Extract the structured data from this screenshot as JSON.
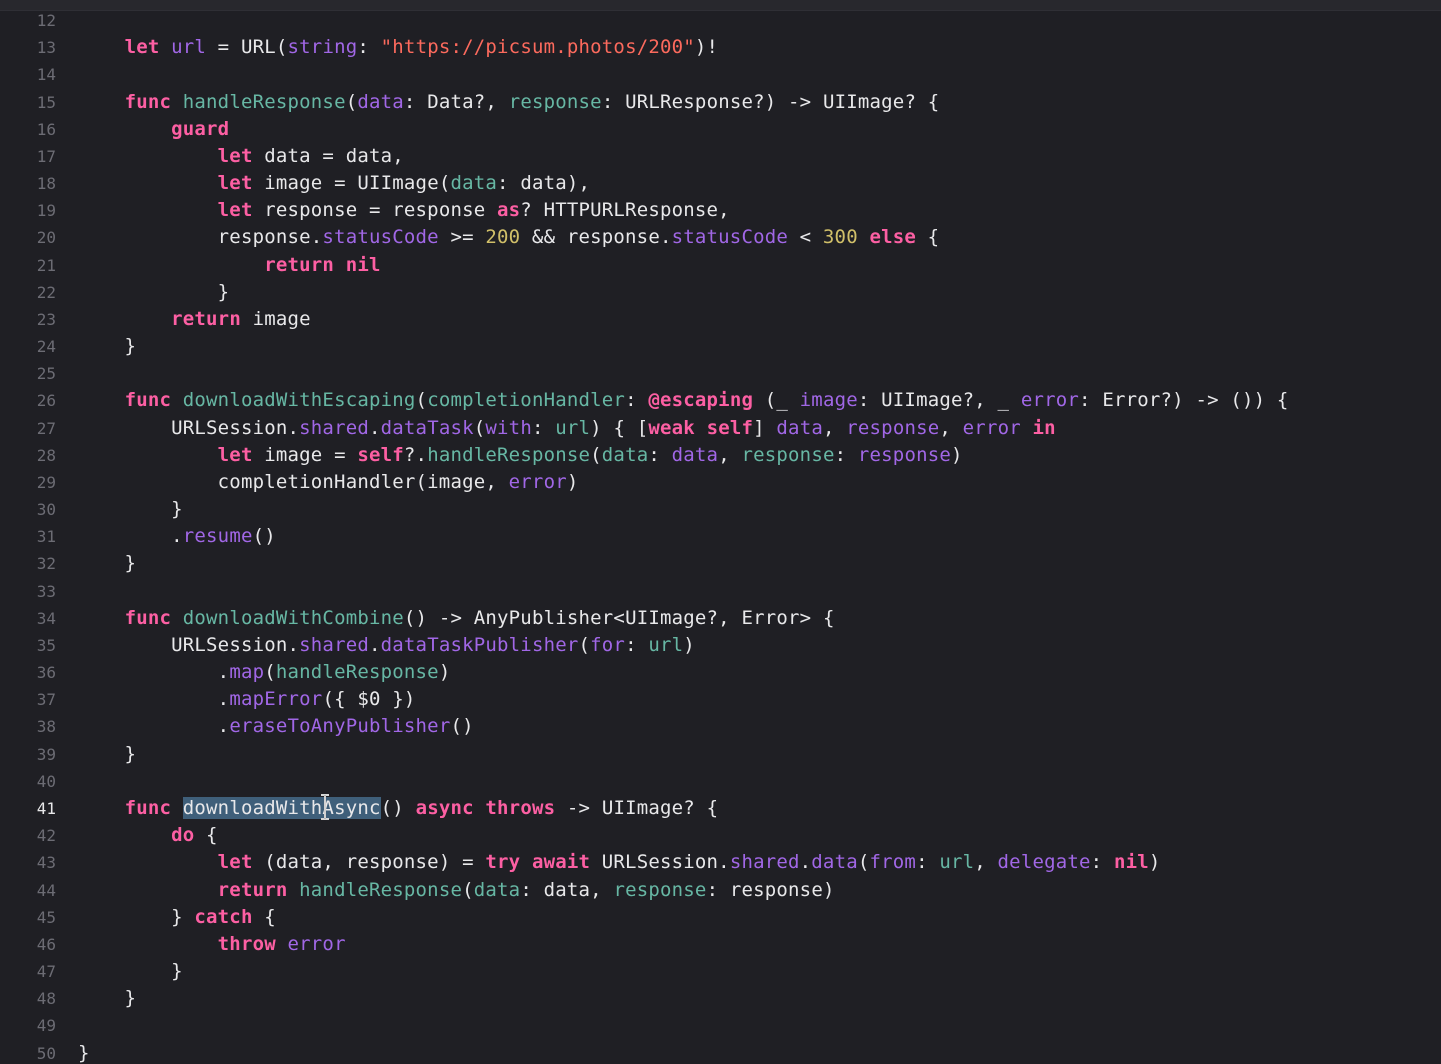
{
  "editor": {
    "current_line": "41",
    "lines": [
      {
        "n": "12",
        "tokens": []
      },
      {
        "n": "13",
        "tokens": [
          [
            "t",
            "    "
          ],
          [
            "kw",
            "let"
          ],
          [
            "t",
            " "
          ],
          [
            "pr",
            "url"
          ],
          [
            "t",
            " = "
          ],
          [
            "tyw",
            "URL"
          ],
          [
            "t",
            "("
          ],
          [
            "pr",
            "string"
          ],
          [
            "t",
            ": "
          ],
          [
            "str",
            "\"https://picsum.photos/200\""
          ],
          [
            "t",
            ")!"
          ]
        ]
      },
      {
        "n": "14",
        "tokens": []
      },
      {
        "n": "15",
        "tokens": [
          [
            "t",
            "    "
          ],
          [
            "kw",
            "func"
          ],
          [
            "t",
            " "
          ],
          [
            "fn",
            "handleResponse"
          ],
          [
            "t",
            "("
          ],
          [
            "pr",
            "data"
          ],
          [
            "t",
            ": "
          ],
          [
            "tyw",
            "Data"
          ],
          [
            "t",
            "?, "
          ],
          [
            "fn",
            "response"
          ],
          [
            "t",
            ": "
          ],
          [
            "tyw",
            "URLResponse"
          ],
          [
            "t",
            "?) -> "
          ],
          [
            "tyw",
            "UIImage"
          ],
          [
            "t",
            "? {"
          ]
        ]
      },
      {
        "n": "16",
        "tokens": [
          [
            "t",
            "        "
          ],
          [
            "kw",
            "guard"
          ]
        ]
      },
      {
        "n": "17",
        "tokens": [
          [
            "t",
            "            "
          ],
          [
            "kw",
            "let"
          ],
          [
            "t",
            " data = data,"
          ]
        ]
      },
      {
        "n": "18",
        "tokens": [
          [
            "t",
            "            "
          ],
          [
            "kw",
            "let"
          ],
          [
            "t",
            " image = "
          ],
          [
            "tyw",
            "UIImage"
          ],
          [
            "t",
            "("
          ],
          [
            "fn",
            "data"
          ],
          [
            "t",
            ": data),"
          ]
        ]
      },
      {
        "n": "19",
        "tokens": [
          [
            "t",
            "            "
          ],
          [
            "kw",
            "let"
          ],
          [
            "t",
            " response = response "
          ],
          [
            "kw",
            "as"
          ],
          [
            "t",
            "? "
          ],
          [
            "tyw",
            "HTTPURLResponse"
          ],
          [
            "t",
            ","
          ]
        ]
      },
      {
        "n": "20",
        "tokens": [
          [
            "t",
            "            response."
          ],
          [
            "pr",
            "statusCode"
          ],
          [
            "t",
            " >= "
          ],
          [
            "num",
            "200"
          ],
          [
            "t",
            " && response."
          ],
          [
            "pr",
            "statusCode"
          ],
          [
            "t",
            " < "
          ],
          [
            "num",
            "300"
          ],
          [
            "t",
            " "
          ],
          [
            "kw",
            "else"
          ],
          [
            "t",
            " {"
          ]
        ]
      },
      {
        "n": "21",
        "tokens": [
          [
            "t",
            "                "
          ],
          [
            "kw",
            "return"
          ],
          [
            "t",
            " "
          ],
          [
            "kw",
            "nil"
          ]
        ]
      },
      {
        "n": "22",
        "tokens": [
          [
            "t",
            "            }"
          ]
        ]
      },
      {
        "n": "23",
        "tokens": [
          [
            "t",
            "        "
          ],
          [
            "kw",
            "return"
          ],
          [
            "t",
            " image"
          ]
        ]
      },
      {
        "n": "24",
        "tokens": [
          [
            "t",
            "    }"
          ]
        ]
      },
      {
        "n": "25",
        "tokens": []
      },
      {
        "n": "26",
        "tokens": [
          [
            "t",
            "    "
          ],
          [
            "kw",
            "func"
          ],
          [
            "t",
            " "
          ],
          [
            "fn",
            "downloadWithEscaping"
          ],
          [
            "t",
            "("
          ],
          [
            "fn",
            "completionHandler"
          ],
          [
            "t",
            ": "
          ],
          [
            "kw",
            "@escaping"
          ],
          [
            "t",
            " (_ "
          ],
          [
            "pr",
            "image"
          ],
          [
            "t",
            ": "
          ],
          [
            "tyw",
            "UIImage"
          ],
          [
            "t",
            "?, _ "
          ],
          [
            "pr",
            "error"
          ],
          [
            "t",
            ": "
          ],
          [
            "tyw",
            "Error"
          ],
          [
            "t",
            "?) -> ()) {"
          ]
        ]
      },
      {
        "n": "27",
        "tokens": [
          [
            "t",
            "        "
          ],
          [
            "tyw",
            "URLSession"
          ],
          [
            "t",
            "."
          ],
          [
            "pr",
            "shared"
          ],
          [
            "t",
            "."
          ],
          [
            "pr",
            "dataTask"
          ],
          [
            "t",
            "("
          ],
          [
            "pr",
            "with"
          ],
          [
            "t",
            ": "
          ],
          [
            "fn",
            "url"
          ],
          [
            "t",
            ") { ["
          ],
          [
            "kw",
            "weak"
          ],
          [
            "t",
            " "
          ],
          [
            "kw",
            "self"
          ],
          [
            "t",
            "] "
          ],
          [
            "pr",
            "data"
          ],
          [
            "t",
            ", "
          ],
          [
            "pr",
            "response"
          ],
          [
            "t",
            ", "
          ],
          [
            "pr",
            "error"
          ],
          [
            "t",
            " "
          ],
          [
            "kw",
            "in"
          ]
        ]
      },
      {
        "n": "28",
        "tokens": [
          [
            "t",
            "            "
          ],
          [
            "kw",
            "let"
          ],
          [
            "t",
            " image = "
          ],
          [
            "kw",
            "self"
          ],
          [
            "t",
            "?."
          ],
          [
            "fn",
            "handleResponse"
          ],
          [
            "t",
            "("
          ],
          [
            "fn",
            "data"
          ],
          [
            "t",
            ": "
          ],
          [
            "pr",
            "data"
          ],
          [
            "t",
            ", "
          ],
          [
            "fn",
            "response"
          ],
          [
            "t",
            ": "
          ],
          [
            "pr",
            "response"
          ],
          [
            "t",
            ")"
          ]
        ]
      },
      {
        "n": "29",
        "tokens": [
          [
            "t",
            "            completionHandler(image, "
          ],
          [
            "pr",
            "error"
          ],
          [
            "t",
            ")"
          ]
        ]
      },
      {
        "n": "30",
        "tokens": [
          [
            "t",
            "        }"
          ]
        ]
      },
      {
        "n": "31",
        "tokens": [
          [
            "t",
            "        ."
          ],
          [
            "pr",
            "resume"
          ],
          [
            "t",
            "()"
          ]
        ]
      },
      {
        "n": "32",
        "tokens": [
          [
            "t",
            "    }"
          ]
        ]
      },
      {
        "n": "33",
        "tokens": []
      },
      {
        "n": "34",
        "tokens": [
          [
            "t",
            "    "
          ],
          [
            "kw",
            "func"
          ],
          [
            "t",
            " "
          ],
          [
            "fn",
            "downloadWithCombine"
          ],
          [
            "t",
            "() -> "
          ],
          [
            "tyw",
            "AnyPublisher"
          ],
          [
            "t",
            "<"
          ],
          [
            "tyw",
            "UIImage"
          ],
          [
            "t",
            "?, "
          ],
          [
            "tyw",
            "Error"
          ],
          [
            "t",
            "> {"
          ]
        ]
      },
      {
        "n": "35",
        "tokens": [
          [
            "t",
            "        "
          ],
          [
            "tyw",
            "URLSession"
          ],
          [
            "t",
            "."
          ],
          [
            "pr",
            "shared"
          ],
          [
            "t",
            "."
          ],
          [
            "pr",
            "dataTaskPublisher"
          ],
          [
            "t",
            "("
          ],
          [
            "pr",
            "for"
          ],
          [
            "t",
            ": "
          ],
          [
            "fn",
            "url"
          ],
          [
            "t",
            ")"
          ]
        ]
      },
      {
        "n": "36",
        "tokens": [
          [
            "t",
            "            ."
          ],
          [
            "pr",
            "map"
          ],
          [
            "t",
            "("
          ],
          [
            "fn",
            "handleResponse"
          ],
          [
            "t",
            ")"
          ]
        ]
      },
      {
        "n": "37",
        "tokens": [
          [
            "t",
            "            ."
          ],
          [
            "pr",
            "mapError"
          ],
          [
            "t",
            "({ $0 })"
          ]
        ]
      },
      {
        "n": "38",
        "tokens": [
          [
            "t",
            "            ."
          ],
          [
            "pr",
            "eraseToAnyPublisher"
          ],
          [
            "t",
            "()"
          ]
        ]
      },
      {
        "n": "39",
        "tokens": [
          [
            "t",
            "    }"
          ]
        ]
      },
      {
        "n": "40",
        "tokens": []
      },
      {
        "n": "41",
        "tokens": [
          [
            "t",
            "    "
          ],
          [
            "kw",
            "func"
          ],
          [
            "t",
            " "
          ],
          [
            "sel",
            "downloadWithAsync"
          ],
          [
            "t",
            "() "
          ],
          [
            "kw",
            "async"
          ],
          [
            "t",
            " "
          ],
          [
            "kw",
            "throws"
          ],
          [
            "t",
            " -> "
          ],
          [
            "tyw",
            "UIImage"
          ],
          [
            "t",
            "? {"
          ]
        ]
      },
      {
        "n": "42",
        "tokens": [
          [
            "t",
            "        "
          ],
          [
            "kw",
            "do"
          ],
          [
            "t",
            " {"
          ]
        ]
      },
      {
        "n": "43",
        "tokens": [
          [
            "t",
            "            "
          ],
          [
            "kw",
            "let"
          ],
          [
            "t",
            " (data, response) = "
          ],
          [
            "kw",
            "try"
          ],
          [
            "t",
            " "
          ],
          [
            "kw",
            "await"
          ],
          [
            "t",
            " "
          ],
          [
            "tyw",
            "URLSession"
          ],
          [
            "t",
            "."
          ],
          [
            "pr",
            "shared"
          ],
          [
            "t",
            "."
          ],
          [
            "pr",
            "data"
          ],
          [
            "t",
            "("
          ],
          [
            "pr",
            "from"
          ],
          [
            "t",
            ": "
          ],
          [
            "fn",
            "url"
          ],
          [
            "t",
            ", "
          ],
          [
            "pr",
            "delegate"
          ],
          [
            "t",
            ": "
          ],
          [
            "kw",
            "nil"
          ],
          [
            "t",
            ")"
          ]
        ]
      },
      {
        "n": "44",
        "tokens": [
          [
            "t",
            "            "
          ],
          [
            "kw",
            "return"
          ],
          [
            "t",
            " "
          ],
          [
            "fn",
            "handleResponse"
          ],
          [
            "t",
            "("
          ],
          [
            "fn",
            "data"
          ],
          [
            "t",
            ": data, "
          ],
          [
            "fn",
            "response"
          ],
          [
            "t",
            ": response)"
          ]
        ]
      },
      {
        "n": "45",
        "tokens": [
          [
            "t",
            "        } "
          ],
          [
            "kw",
            "catch"
          ],
          [
            "t",
            " {"
          ]
        ]
      },
      {
        "n": "46",
        "tokens": [
          [
            "t",
            "            "
          ],
          [
            "kw",
            "throw"
          ],
          [
            "t",
            " "
          ],
          [
            "pr",
            "error"
          ]
        ]
      },
      {
        "n": "47",
        "tokens": [
          [
            "t",
            "        }"
          ]
        ]
      },
      {
        "n": "48",
        "tokens": [
          [
            "t",
            "    }"
          ]
        ]
      },
      {
        "n": "49",
        "tokens": []
      },
      {
        "n": "50",
        "tokens": [
          [
            "t",
            "}"
          ]
        ]
      }
    ]
  }
}
